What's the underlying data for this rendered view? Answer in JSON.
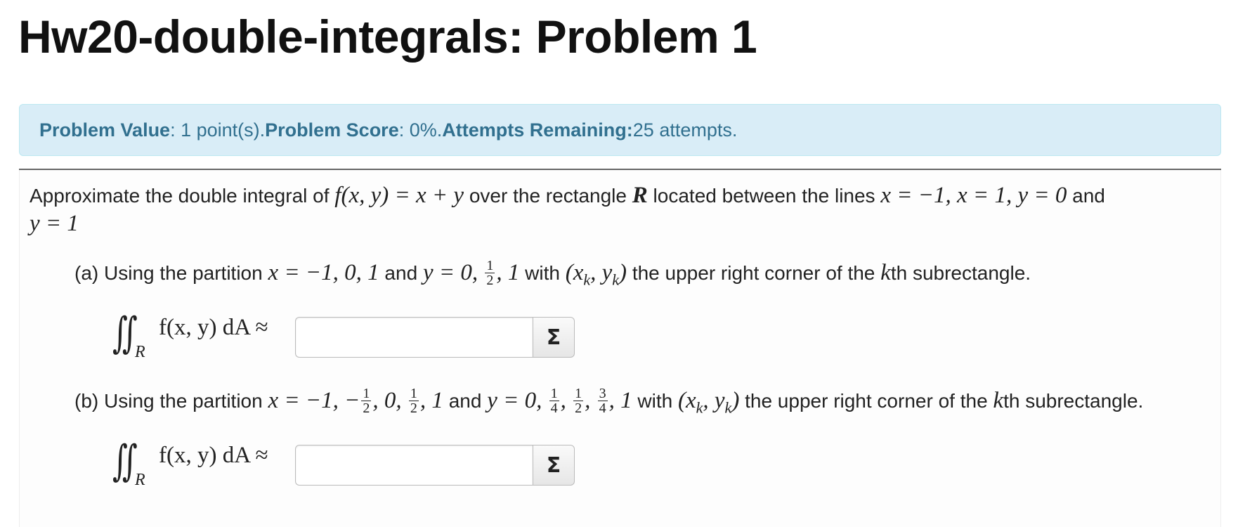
{
  "page": {
    "title": "Hw20-double-integrals: Problem 1"
  },
  "info": {
    "value_label": "Problem Value",
    "value_text": ": 1 point(s). ",
    "score_label": "Problem Score",
    "score_text": ": 0%. ",
    "attempts_label": "Attempts Remaining:",
    "attempts_text": " 25 attempts."
  },
  "problem": {
    "intro_1": "Approximate the double integral of ",
    "fxy": "f(x, y) = x + y",
    "intro_2": " over the rectangle ",
    "R": "R",
    "intro_3": " located between the lines ",
    "lines": "x = −1, x = 1, y = 0",
    "intro_4": " and",
    "y1": "y = 1",
    "part_a": {
      "prefix": "(a) Using the partition ",
      "x_partition": "x = −1, 0, 1",
      "and": " and ",
      "y_start": "y = 0, ",
      "y_frac_num": "1",
      "y_frac_den": "2",
      "y_end": ", 1",
      "with": " with ",
      "point": "(x",
      "point_sub_k": "k",
      "point_mid": ", y",
      "point_end": ")",
      "suffix_1": " the upper right corner of the ",
      "k": "k",
      "suffix_2": "th subrectangle."
    },
    "part_b": {
      "prefix": "(b) Using the partition ",
      "x_start": "x = −1, −",
      "x_f1_num": "1",
      "x_f1_den": "2",
      "x_mid": ", 0, ",
      "x_f2_num": "1",
      "x_f2_den": "2",
      "x_end": ", 1",
      "and": " and ",
      "y_start": "y = 0, ",
      "y_f1_num": "1",
      "y_f1_den": "4",
      "y_f2_num": "1",
      "y_f2_den": "2",
      "y_f3_num": "3",
      "y_f3_den": "4",
      "y_end": ", 1",
      "with": " with ",
      "suffix_1": " the upper right corner of the ",
      "suffix_2": "th subrectangle."
    },
    "integral": {
      "sign": "∬",
      "region": "R",
      "expr": "f(x, y) dA ≈"
    },
    "answer_a": {
      "value": "",
      "placeholder": ""
    },
    "answer_b": {
      "value": "",
      "placeholder": ""
    },
    "equation_editor_label": "Σ"
  }
}
